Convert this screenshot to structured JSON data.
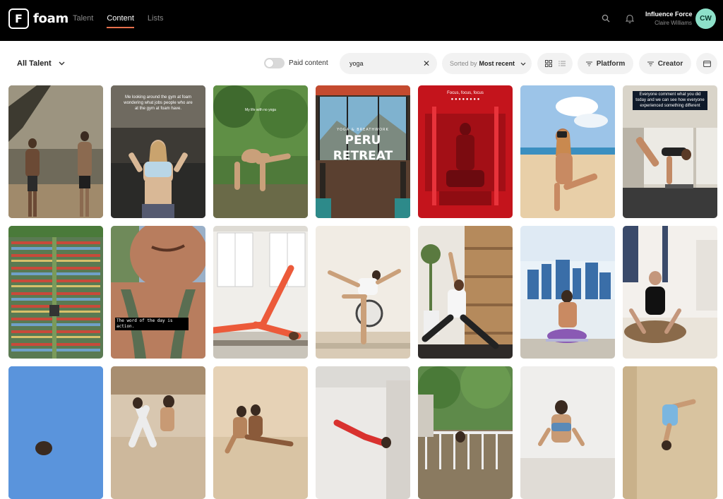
{
  "app": {
    "logo_text": "foam",
    "logo_mark": "F"
  },
  "nav": {
    "items": [
      "Talent",
      "Content",
      "Lists"
    ],
    "active": "Content"
  },
  "user": {
    "name": "Influence Force",
    "subtitle": "Claire Williams",
    "initials": "CW",
    "avatar_color": "#8de0c9"
  },
  "icons": {
    "search": "search-icon",
    "notifications": "bell-icon"
  },
  "toolbar": {
    "talent_select": "All Talent",
    "paid_label": "Paid content",
    "paid_enabled": false,
    "search_value": "yoga",
    "sort_prefix": "Sorted by",
    "sort_value": "Most recent",
    "platform_label": "Platform",
    "creator_label": "Creator"
  },
  "accent": "#e8704c",
  "captions": {
    "c2": "Me looking around the gym at foam wondering what jobs people who are at the gym at foam have.",
    "c3": "My life with no yoga",
    "c4_small": "YOGA & BREATHWORK",
    "c4_title_1": "PERU",
    "c4_title_2": "RETREAT",
    "c5": "Focus, focus, focus",
    "c7": "Everyone comment what you did today and we can see how everyone experienced something different",
    "c9": "The word of the day is action."
  }
}
